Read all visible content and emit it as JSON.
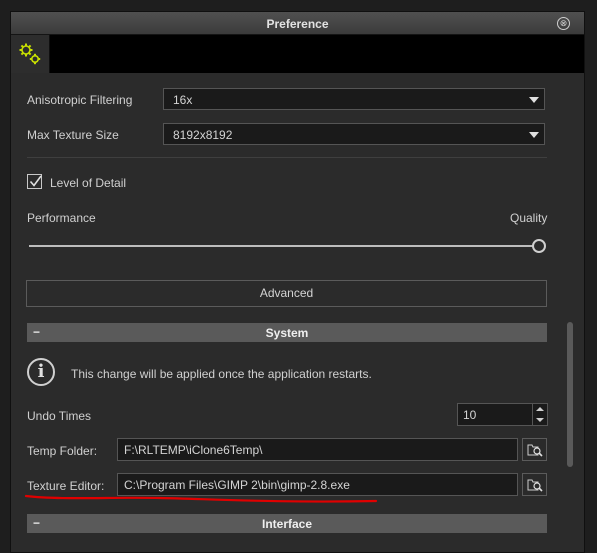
{
  "window": {
    "title": "Preference",
    "close_glyph": "⊗"
  },
  "tabs": [
    {
      "icon": "gears-icon",
      "selected": true
    }
  ],
  "render": {
    "anisotropic_label": "Anisotropic Filtering",
    "anisotropic_value": "16x",
    "max_texture_label": "Max Texture Size",
    "max_texture_value": "8192x8192",
    "level_of_detail_label": "Level of Detail",
    "level_of_detail_checked": true,
    "performance_label": "Performance",
    "quality_label": "Quality",
    "slider_value": 1.0,
    "advanced_label": "Advanced"
  },
  "system": {
    "header": "System",
    "collapse_glyph": "−",
    "info_glyph": "i",
    "restart_notice": "This change will be applied once the application restarts.",
    "undo_times_label": "Undo Times",
    "undo_times_value": "10",
    "temp_folder_label": "Temp Folder:",
    "temp_folder_value": "F:\\RLTEMP\\iClone6Temp\\",
    "texture_editor_label": "Texture Editor:",
    "texture_editor_value": "C:\\Program Files\\GIMP 2\\bin\\gimp-2.8.exe"
  },
  "interface": {
    "header": "Interface",
    "collapse_glyph": "−"
  },
  "colors": {
    "accent_icon": "#c8e000",
    "annotation_red": "#e00000",
    "section_header_bg": "#5a5a5a"
  }
}
